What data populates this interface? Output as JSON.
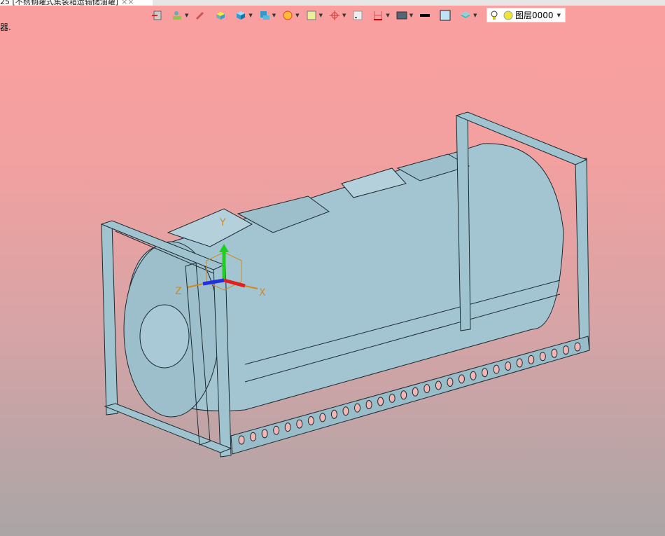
{
  "tab": {
    "title": "25 [不锈钢罐式集装箱运输储油罐]",
    "close": "××"
  },
  "status_text": "器.",
  "toolbar": {
    "items": [
      {
        "icon": "exit-icon",
        "dropdown": false
      },
      {
        "icon": "layer-manager-icon",
        "dropdown": true
      },
      {
        "icon": "pencil-eraser-icon",
        "dropdown": false
      },
      {
        "icon": "box-yellow-icon",
        "dropdown": false
      },
      {
        "icon": "cube-solid-icon",
        "dropdown": true
      },
      {
        "icon": "view-cube-icon",
        "dropdown": true
      },
      {
        "icon": "render-sphere-icon",
        "dropdown": true
      },
      {
        "icon": "render-style-icon",
        "dropdown": true
      },
      {
        "icon": "snap-target-icon",
        "dropdown": true
      },
      {
        "icon": "window-icon",
        "dropdown": false
      },
      {
        "icon": "section-icon",
        "dropdown": true
      },
      {
        "icon": "display-icon",
        "dropdown": true
      },
      {
        "icon": "line-color-icon",
        "dropdown": false
      },
      {
        "icon": "fill-color-icon",
        "dropdown": false
      },
      {
        "icon": "layers-icon",
        "dropdown": true
      }
    ]
  },
  "layer": {
    "name": "图层0000"
  },
  "triad": {
    "x": "X",
    "y": "Y",
    "z": "Z"
  },
  "colors": {
    "model": "#9fc3cf",
    "edge": "#1a2a30",
    "bg_top": "#fb9f9f",
    "bg_bottom": "#aaa5a6"
  }
}
